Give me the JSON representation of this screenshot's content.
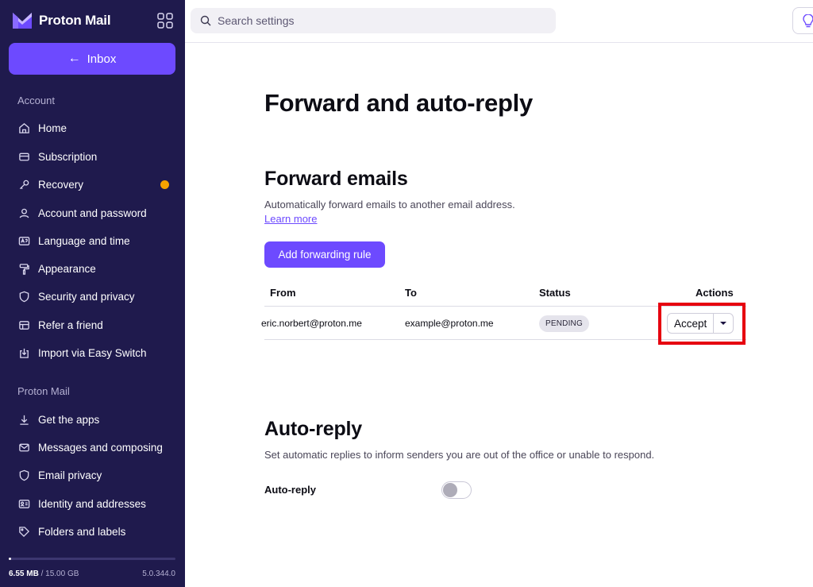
{
  "brand": {
    "name": "Proton Mail"
  },
  "sidebar": {
    "inbox_label": "Inbox",
    "sections": [
      {
        "title": "Account",
        "items": [
          {
            "label": "Home",
            "icon": "home-icon"
          },
          {
            "label": "Subscription",
            "icon": "credit-card-icon"
          },
          {
            "label": "Recovery",
            "icon": "key-icon",
            "badge_color": "#f5a200"
          },
          {
            "label": "Account and password",
            "icon": "user-icon"
          },
          {
            "label": "Language and time",
            "icon": "language-icon"
          },
          {
            "label": "Appearance",
            "icon": "paint-roller-icon"
          },
          {
            "label": "Security and privacy",
            "icon": "shield-icon"
          },
          {
            "label": "Refer a friend",
            "icon": "gift-icon"
          },
          {
            "label": "Import via Easy Switch",
            "icon": "import-icon"
          }
        ]
      },
      {
        "title": "Proton Mail",
        "items": [
          {
            "label": "Get the apps",
            "icon": "download-icon"
          },
          {
            "label": "Messages and composing",
            "icon": "envelope-icon"
          },
          {
            "label": "Email privacy",
            "icon": "shield-icon"
          },
          {
            "label": "Identity and addresses",
            "icon": "id-card-icon"
          },
          {
            "label": "Folders and labels",
            "icon": "tag-icon"
          }
        ]
      }
    ],
    "storage": {
      "used": "6.55 MB",
      "separator": " / ",
      "total": "15.00 GB",
      "used_fraction": 0.0004
    },
    "version": "5.0.344.0"
  },
  "topbar": {
    "search_placeholder": "Search settings"
  },
  "main": {
    "title": "Forward and auto-reply",
    "forward": {
      "heading": "Forward emails",
      "description": "Automatically forward emails to another email address.",
      "learn_more": "Learn more",
      "add_button": "Add forwarding rule",
      "columns": [
        "From",
        "To",
        "Status",
        "Actions"
      ],
      "rows": [
        {
          "from": "eric.norbert@proton.me",
          "to": "example@proton.me",
          "status": "PENDING",
          "action": "Accept"
        }
      ]
    },
    "autoreply": {
      "heading": "Auto-reply",
      "description": "Set automatic replies to inform senders you are out of the office or unable to respond.",
      "label": "Auto-reply",
      "enabled": false
    }
  },
  "colors": {
    "accent": "#6d4aff",
    "sidebar_bg": "#1f1a4d",
    "highlight": "#e6000f",
    "badge": "#f5a200"
  }
}
